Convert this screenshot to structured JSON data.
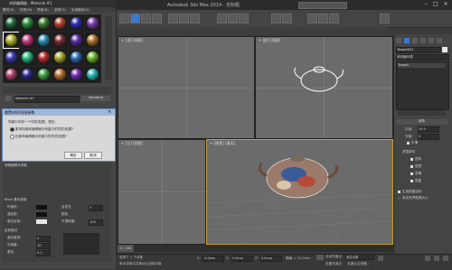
{
  "app": {
    "title": "Autodesk 3ds Max 2014 · 无标题",
    "search_placeholder": "键入关键字或短语"
  },
  "material_editor": {
    "title": "材质编辑器 - Material #1",
    "menu": [
      "模式(D)",
      "材质(M)",
      "导航(N)",
      "选项(O)",
      "实用程序(U)"
    ],
    "material_name": "Material #1",
    "material_type": "Standard",
    "balls": [
      "#1f6a3a",
      "#2a8a3d",
      "#3b7a2a",
      "#b23f2a",
      "#2a2fb0",
      "#7a3ab0",
      "#b0b02a",
      "#c03a7a",
      "#2a8ab0",
      "#7a2a2a",
      "#5a2aa8",
      "#b0702a",
      "#3a3ab0",
      "#2ab07a",
      "#b02a2a",
      "#a0a02a",
      "#2a6ab0",
      "#6ab02a",
      "#b03a6a",
      "#2a2a8a",
      "#3a9a3a",
      "#b06a2a",
      "#6a2ab0",
      "#2ab0b0"
    ],
    "params_labels": [
      "明暗器基本参数",
      "Blinn 基本参数",
      "环境光:",
      "漫反射:",
      "高光反射:",
      "自发光",
      "颜色",
      "不透明度:",
      "反射高光",
      "高光级别:",
      "光泽度:",
      "柔化:"
    ],
    "values": [
      "0",
      "100",
      "0",
      "10",
      "0.1"
    ]
  },
  "dialog": {
    "title": "重置材质/贴图参数",
    "question": "场景中存有一个材质/贴图，是否:",
    "option1": "影响场景和编辑器示例窗中的材质/贴图?",
    "option2": "仅影响编辑器示例窗中的材质/贴图?",
    "ok_label": "确定",
    "cancel_label": "取消"
  },
  "viewports": {
    "top_label": "+ [顶] [线框]",
    "front_label": "+ [前] [线框]",
    "left_label": "+ [左] [线框]",
    "persp_label": "+ [透视] [真实]"
  },
  "command_panel": {
    "object_name": "Teapot001",
    "modifier_list": "修改器列表",
    "stack_item": "Teapot",
    "params_title": "参数",
    "radius_label": "半径:",
    "radius_value": "29.5",
    "segments_label": "分段:",
    "segments_value": "4",
    "smooth_label": "平滑",
    "parts_title": "茶壶部件",
    "parts": [
      "壶体",
      "壶把",
      "壶嘴",
      "壶盖"
    ],
    "gen_uv": "生成贴图坐标",
    "real_world": "真实世界贴图大小"
  },
  "status": {
    "frame": "0 / 100",
    "selected": "选择了 1 个对象",
    "hint": "单击或单击并拖动以选择对象",
    "x_label": "X:",
    "x_value": "-0.0mm",
    "y_label": "Y:",
    "y_value": "0.0mm",
    "z_label": "Z:",
    "z_value": "0.0mm",
    "grid": "栅格 = 10.0mm",
    "auto_key": "自动关键点",
    "selection_set": "选定对象",
    "set_key": "设置关键点",
    "key_filters": "关键点过滤器..."
  }
}
